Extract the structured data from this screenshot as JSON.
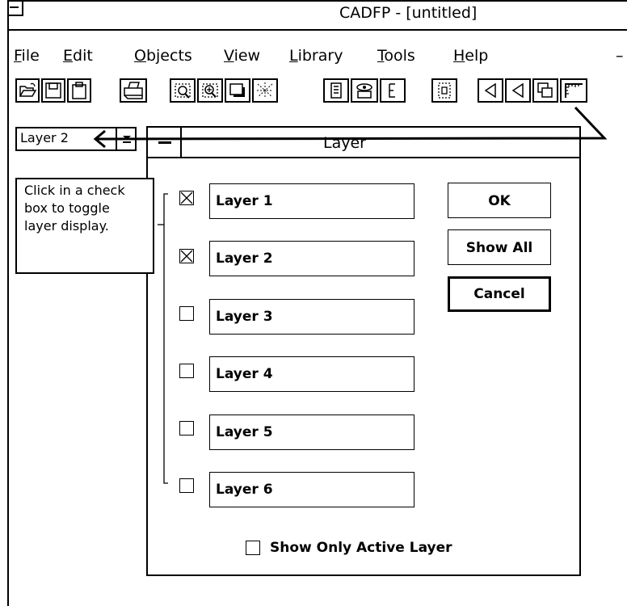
{
  "app": {
    "title": "CADFP - [untitled]"
  },
  "menubar": {
    "items": [
      {
        "accel": "F",
        "rest": "ile"
      },
      {
        "accel": "E",
        "rest": "dit"
      },
      {
        "accel": "O",
        "rest": "bjects"
      },
      {
        "accel": "V",
        "rest": "iew"
      },
      {
        "accel": "L",
        "rest": "ibrary"
      },
      {
        "accel": "T",
        "rest": "ools"
      },
      {
        "accel": "H",
        "rest": "elp"
      }
    ],
    "trailing": "–"
  },
  "toolbar": {
    "icons": [
      "open-icon",
      "save-icon",
      "clipboard-icon",
      "print-icon",
      "zoom-window-icon",
      "zoom-fit-icon",
      "shadow-icon",
      "grid-select-icon",
      "properties-icon",
      "view-icon",
      "text-icon",
      "frame-icon",
      "triangle-left-icon",
      "triangle-left-icon",
      "overlap-icon",
      "ruler-icon"
    ]
  },
  "layer_combo": {
    "value": "Layer 2"
  },
  "tooltip": {
    "lines": [
      "Click in a check",
      "box to toggle",
      "layer display."
    ]
  },
  "dialog": {
    "title": "Layer",
    "layers": [
      {
        "name": "Layer 1",
        "checked": true
      },
      {
        "name": "Layer 2",
        "checked": true
      },
      {
        "name": "Layer 3",
        "checked": false
      },
      {
        "name": "Layer 4",
        "checked": false
      },
      {
        "name": "Layer 5",
        "checked": false
      },
      {
        "name": "Layer 6",
        "checked": false
      }
    ],
    "buttons": {
      "ok": "OK",
      "show_all": "Show All",
      "cancel": "Cancel"
    },
    "show_only_active": {
      "label": "Show Only Active Layer",
      "checked": false
    }
  }
}
